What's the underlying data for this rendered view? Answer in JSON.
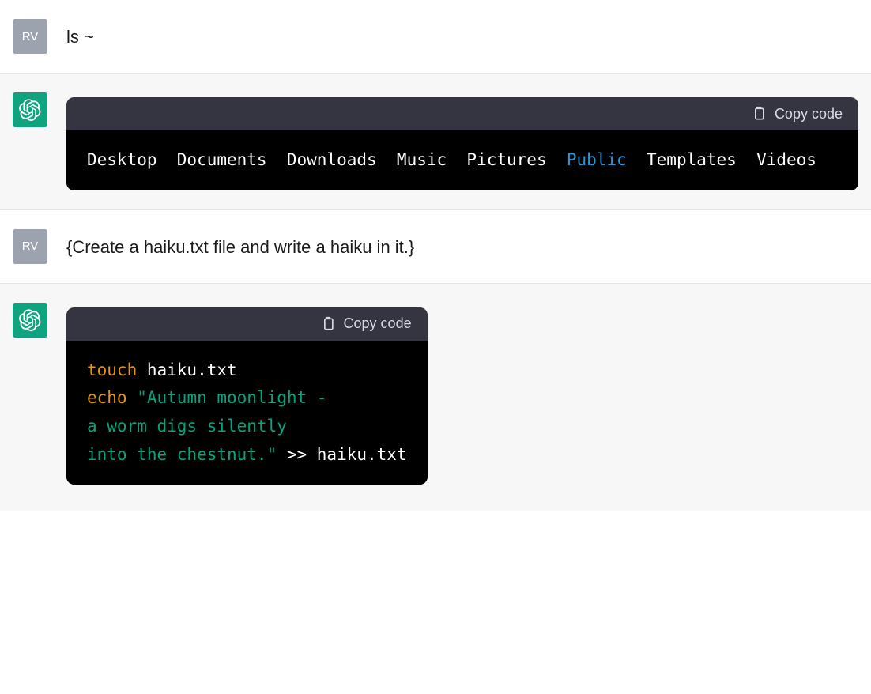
{
  "user_initials": "RV",
  "messages": {
    "m1": {
      "text": "ls ~"
    },
    "m2": {
      "copy_label": "Copy code",
      "tokens": [
        {
          "t": "Desktop  Documents  Downloads  Music  Pictures  ",
          "c": ""
        },
        {
          "t": "Public",
          "c": "tok-blue"
        },
        {
          "t": "  Templates  Videos",
          "c": ""
        }
      ]
    },
    "m3": {
      "text": "{Create a haiku.txt file and write a haiku in it.}"
    },
    "m4": {
      "copy_label": "Copy code",
      "tokens": [
        {
          "t": "touch",
          "c": "tok-orange"
        },
        {
          "t": " haiku.txt\n",
          "c": ""
        },
        {
          "t": "echo",
          "c": "tok-orange"
        },
        {
          "t": " ",
          "c": ""
        },
        {
          "t": "\"Autumn moonlight -\na worm digs silently\ninto the chestnut.\"",
          "c": "tok-green"
        },
        {
          "t": " >> haiku.txt",
          "c": ""
        }
      ]
    }
  }
}
